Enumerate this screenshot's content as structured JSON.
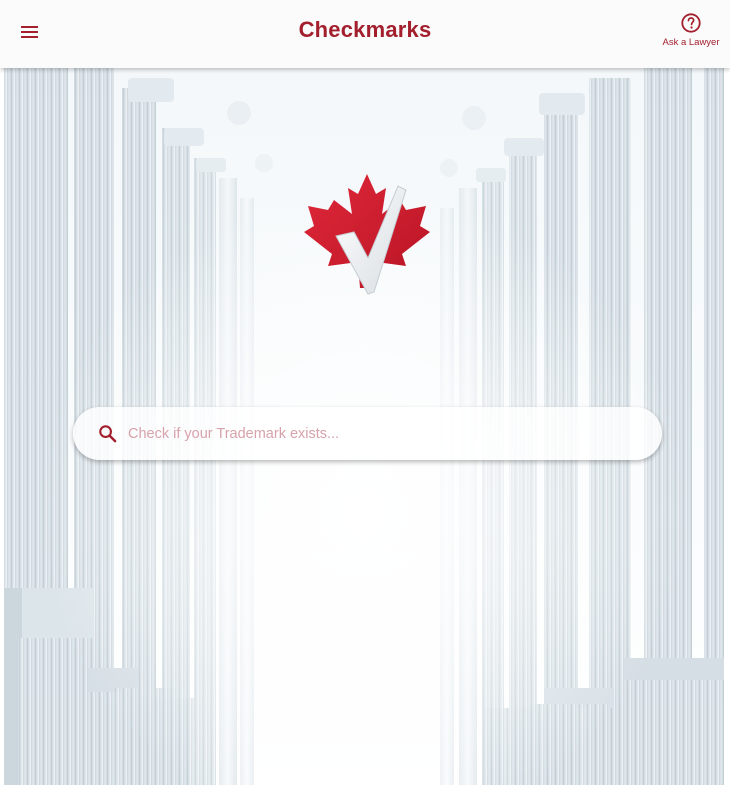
{
  "appbar": {
    "title": "Checkmarks",
    "menu_icon": "hamburger-menu-icon",
    "ask_lawyer_label": "Ask a Lawyer",
    "ask_lawyer_icon": "help-circle-icon"
  },
  "hero": {
    "background": "white-columns-lamp-posts-photo",
    "logo": "maple-leaf-checkmark-logo"
  },
  "search": {
    "placeholder": "Check if your Trademark exists...",
    "value": "",
    "icon": "search-icon"
  },
  "colors": {
    "brand": "#a31f2e",
    "appbar_bg": "#fbfbfb",
    "placeholder": "#d7a2ab"
  }
}
